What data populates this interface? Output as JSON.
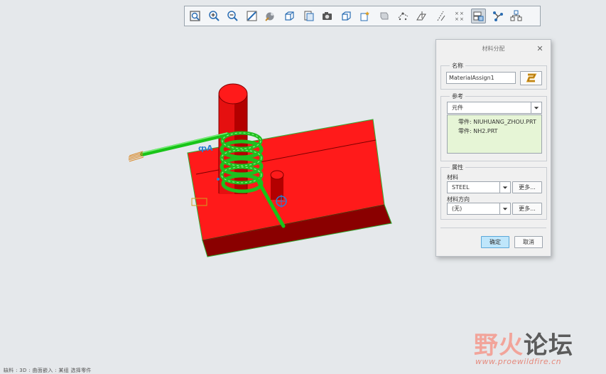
{
  "toolbar": {
    "buttons": [
      {
        "name": "refit-icon"
      },
      {
        "name": "zoom-in-icon"
      },
      {
        "name": "zoom-out-icon"
      },
      {
        "name": "repaint-icon"
      },
      {
        "name": "display-style-icon"
      },
      {
        "name": "saved-orientations-icon"
      },
      {
        "name": "view-manager-icon"
      },
      {
        "name": "perspective-view-icon"
      },
      {
        "name": "section-icon"
      },
      {
        "name": "annotation-display-icon"
      },
      {
        "name": "spin-center-icon"
      },
      {
        "name": "datum-planes-icon"
      },
      {
        "name": "datum-axes-icon"
      },
      {
        "name": "datum-points-icon"
      },
      {
        "name": "csys-display-icon"
      },
      {
        "name": "model-tree-icon",
        "active": true
      },
      {
        "name": "connections-icon"
      },
      {
        "name": "assembly-icon"
      }
    ]
  },
  "dialog": {
    "title": "材料分配",
    "close": "✕",
    "name_group": {
      "label": "名称",
      "value": "MaterialAssign1"
    },
    "ref_group": {
      "label": "参考",
      "type_value": "元件",
      "items": [
        "零件: NIUHUANG_ZHOU.PRT",
        "零件: NH2.PRT"
      ]
    },
    "prop_group": {
      "label": "属性",
      "material_label": "材料",
      "material_value": "STEEL",
      "more1": "更多...",
      "direction_label": "材料方向",
      "direction_value": "(无)",
      "more2": "更多..."
    },
    "ok": "确定",
    "cancel": "取消"
  },
  "status_bar": "缺料 : 3D : 曲面嵌入 : 某组 选择零件",
  "watermark": {
    "text_a": "野火",
    "text_b": "论坛",
    "url": "www.proewildfire.cn"
  },
  "colors": {
    "body": "#ff1a1a",
    "dark": "#8a0000",
    "spring": "#22dd22",
    "accent": "#2a7fd0"
  }
}
